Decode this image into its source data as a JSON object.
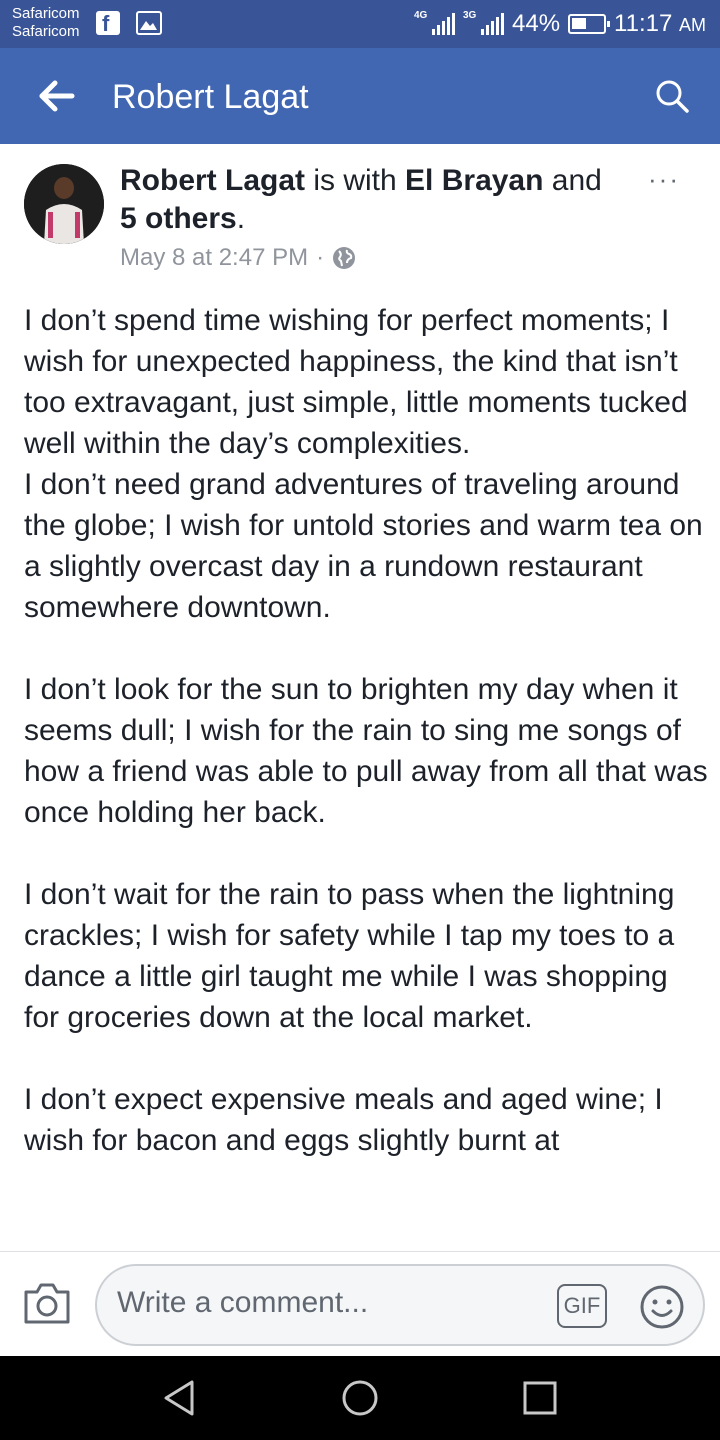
{
  "status_bar": {
    "carrier_line1": "Safaricom",
    "carrier_line2": "Safaricom",
    "network1": "4G",
    "network2": "3G",
    "battery": "44%",
    "time": "11:17",
    "ampm": "AM",
    "icons": [
      "facebook-icon",
      "gallery-icon",
      "signal-icon",
      "battery-icon"
    ]
  },
  "header": {
    "title": "Robert Lagat",
    "back_icon": "back-arrow-icon",
    "search_icon": "search-icon"
  },
  "post": {
    "author": "Robert Lagat",
    "with_text": " is with ",
    "tagged": "El Brayan",
    "and_text": " and ",
    "others": "5 others",
    "period": ".",
    "timestamp": "May 8 at 2:47 PM",
    "separator": "·",
    "privacy_icon": "globe-icon",
    "more": "···",
    "paragraphs": [
      "I don’t spend time wishing for perfect moments; I wish for unexpected happiness, the kind that isn’t too extravagant, just simple, little moments tucked well within the day’s complexities.",
      "I don’t need grand adventures of traveling around the globe; I wish for untold stories and warm tea on a slightly overcast day in a rundown restaurant somewhere downtown.",
      "I don’t look for the sun to brighten my day when it seems dull; I wish for the rain to sing me songs of how a friend was able to pull away from all that was once holding her back.",
      "I don’t wait for the rain to pass when the lightning crackles; I wish for safety while I tap my toes to a dance a little girl taught me while I was shopping for groceries down at the local market.",
      "I don’t expect expensive meals and aged wine; I wish for bacon and eggs slightly burnt at"
    ]
  },
  "comment_bar": {
    "placeholder": "Write a comment...",
    "gif_label": "GIF",
    "camera_icon": "camera-icon",
    "emoji_icon": "smiley-icon"
  },
  "nav_bar": {
    "icons": [
      "back-triangle-icon",
      "home-circle-icon",
      "recents-square-icon"
    ]
  },
  "colors": {
    "status_bar": "#3a5597",
    "app_bar": "#4267b2",
    "text": "#1d2129",
    "meta": "#90949c"
  }
}
